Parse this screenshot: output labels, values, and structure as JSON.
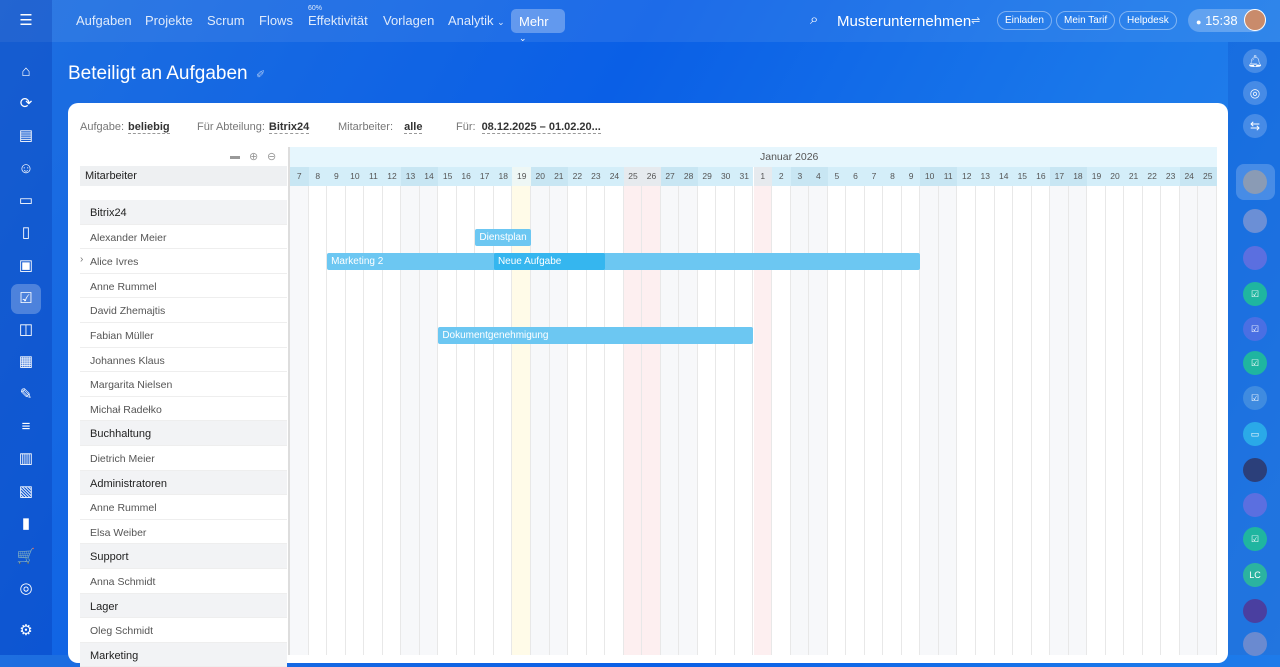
{
  "topnav": {
    "items": [
      "Aufgaben",
      "Projekte",
      "Scrum",
      "Flows",
      "Effektivität",
      "Vorlagen",
      "Analytik"
    ],
    "efficiency_badge": "60%",
    "more": "Mehr",
    "company": "Musterunternehmen",
    "invite": "Einladen",
    "tariff": "Mein Tarif",
    "helpdesk": "Helpdesk",
    "time": "15:38"
  },
  "page": {
    "title": "Beteiligt an Aufgaben"
  },
  "filters": {
    "task_label": "Aufgabe:",
    "task_value": "beliebig",
    "dept_label": "Für Abteilung:",
    "dept_value": "Bitrix24",
    "emp_label": "Mitarbeiter:",
    "emp_value": "alle",
    "period_label": "Für:",
    "period_value": "08.12.2025 – 01.02.20..."
  },
  "list": {
    "header": "Mitarbeiter",
    "rows": [
      {
        "type": "group",
        "label": "Bitrix24"
      },
      {
        "type": "user",
        "label": "Alexander Meier"
      },
      {
        "type": "user",
        "label": "Alice Ivres",
        "expand": true
      },
      {
        "type": "user",
        "label": "Anne Rummel"
      },
      {
        "type": "user",
        "label": "David Zhemajtis"
      },
      {
        "type": "user",
        "label": "Fabian Müller"
      },
      {
        "type": "user",
        "label": "Johannes Klaus"
      },
      {
        "type": "user",
        "label": "Margarita Nielsen"
      },
      {
        "type": "user",
        "label": "Michał Radełko"
      },
      {
        "type": "group",
        "label": "Buchhaltung"
      },
      {
        "type": "user",
        "label": "Dietrich Meier"
      },
      {
        "type": "group",
        "label": "Administratoren"
      },
      {
        "type": "user",
        "label": "Anne Rummel"
      },
      {
        "type": "user",
        "label": "Elsa Weiber"
      },
      {
        "type": "group",
        "label": "Support"
      },
      {
        "type": "user",
        "label": "Anna Schmidt"
      },
      {
        "type": "group",
        "label": "Lager"
      },
      {
        "type": "user",
        "label": "Oleg Schmidt"
      },
      {
        "type": "group",
        "label": "Marketing"
      }
    ]
  },
  "gantt": {
    "month_label": "Januar 2026",
    "days": [
      7,
      8,
      9,
      10,
      11,
      12,
      13,
      14,
      15,
      16,
      17,
      18,
      19,
      20,
      21,
      22,
      23,
      24,
      25,
      26,
      27,
      28,
      29,
      30,
      31,
      1,
      2,
      3,
      4,
      5,
      6,
      7,
      8,
      9,
      10,
      11,
      12,
      13,
      14,
      15,
      16,
      17,
      18,
      19,
      20,
      21,
      22,
      23,
      24,
      25
    ],
    "weekend_index": [
      0,
      6,
      7,
      13,
      14,
      20,
      21,
      27,
      28,
      34,
      35,
      41,
      42,
      48,
      49
    ],
    "holiday_index": [
      18,
      19,
      25
    ],
    "today_index": 12,
    "tasks": [
      {
        "name": "Dienstplan",
        "row": 1,
        "start": 10,
        "end": 12,
        "color": "#6cc7f2"
      },
      {
        "name": "Marketing 2",
        "row": 2,
        "start": 2,
        "end": 33,
        "color": "#6cc7f2"
      },
      {
        "name": "Neue Aufgabe",
        "row": 2,
        "start": 11,
        "end": 16,
        "color": "#35b6ef"
      },
      {
        "name": "Dokumentgenehmigung",
        "row": 5,
        "start": 8,
        "end": 24,
        "color": "#6cc7f2"
      }
    ]
  }
}
